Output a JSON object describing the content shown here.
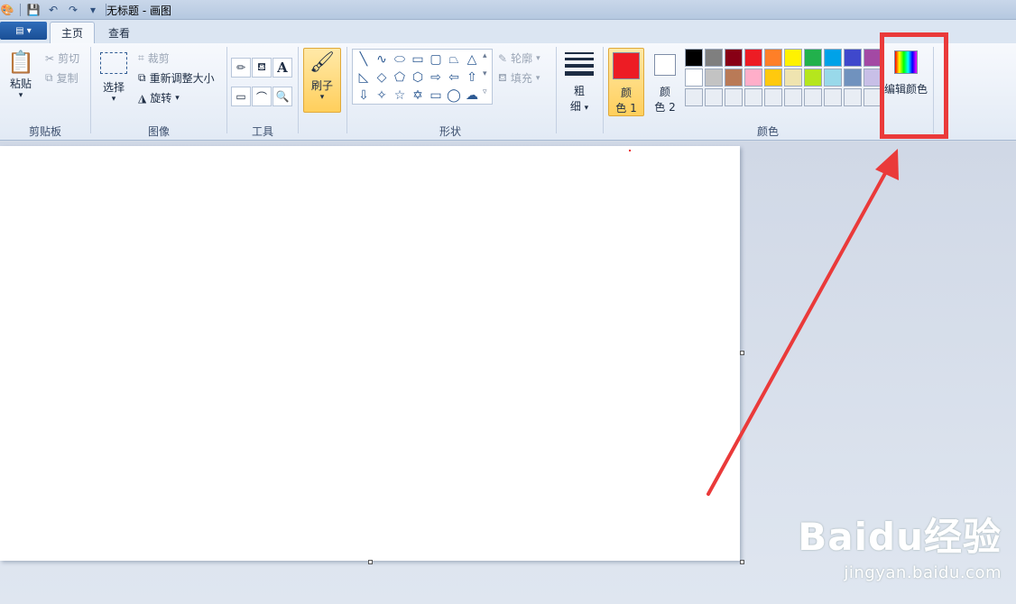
{
  "window": {
    "title": "无标题 - 画图"
  },
  "tabs": {
    "home": "主页",
    "view": "查看"
  },
  "clipboard": {
    "paste": "粘贴",
    "cut": "剪切",
    "copy": "复制",
    "label": "剪贴板"
  },
  "image": {
    "select": "选择",
    "crop": "裁剪",
    "resize": "重新调整大小",
    "rotate": "旋转",
    "label": "图像"
  },
  "tools": {
    "label": "工具",
    "text_glyph": "A"
  },
  "brushes": {
    "label": "刷子"
  },
  "shapes": {
    "outline": "轮廓",
    "fill": "填充",
    "label": "形状"
  },
  "size": {
    "label_line1": "粗",
    "label_line2": "细"
  },
  "colors": {
    "color1_line1": "颜",
    "color1_line2": "色 1",
    "color2_line1": "颜",
    "color2_line2": "色 2",
    "color1_value": "#ed1c24",
    "color2_value": "#ffffff",
    "edit_colors": "编辑颜色",
    "label": "颜色",
    "palette_row1": [
      "#000000",
      "#7f7f7f",
      "#880015",
      "#ed1c24",
      "#ff7f27",
      "#fff200",
      "#22b14c",
      "#00a2e8",
      "#3f48cc",
      "#a349a4"
    ],
    "palette_row2": [
      "#ffffff",
      "#c3c3c3",
      "#b97a57",
      "#ffaec9",
      "#ffc90e",
      "#efe4b0",
      "#b5e61d",
      "#99d9ea",
      "#7092be",
      "#c8bfe7"
    ],
    "palette_row3": [
      "#e8edf4",
      "#e8edf4",
      "#e8edf4",
      "#e8edf4",
      "#e8edf4",
      "#e8edf4",
      "#e8edf4",
      "#e8edf4",
      "#e8edf4",
      "#e8edf4"
    ]
  },
  "watermark": {
    "logo": "Baidu经验",
    "url": "jingyan.baidu.com"
  },
  "annotation_color": "#ea3a3a"
}
